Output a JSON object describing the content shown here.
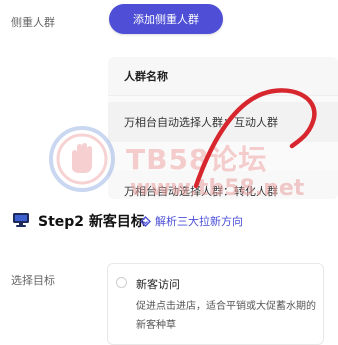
{
  "focus_crowd": {
    "label": "侧重人群",
    "add_button": "添加侧重人群"
  },
  "crowd_table": {
    "header": "人群名称",
    "rows": [
      "万相台自动选择人群：互动人群",
      "万相台自动选择人群：转化人群"
    ]
  },
  "step2": {
    "title": "Step2 新客目标",
    "link": "解析三大拉新方向"
  },
  "goal": {
    "label": "选择目标",
    "option_name": "新客访问",
    "option_desc": "促进点击进店，适合平销或大促蓄水期的新客种草"
  },
  "watermark": {
    "title": "TB58论坛",
    "url": "www.tb58.net"
  },
  "colors": {
    "accent": "#4e4fd6",
    "scribble": "#d7262e"
  },
  "icons": {
    "step_icon": "monitor-icon",
    "link_icon": "diamond-icon",
    "watermark_logo": "hand-logo"
  }
}
